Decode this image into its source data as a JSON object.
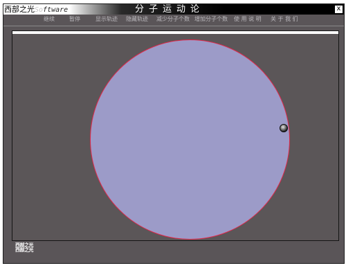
{
  "titlebar": {
    "logo_cn": "西部之光",
    "logo_so": "So",
    "logo_ftware": "ftware",
    "title": "分子运动论",
    "close_label": "x"
  },
  "menu": {
    "items": [
      {
        "label": "继续"
      },
      {
        "label": "暂停"
      },
      {
        "label": "显示轨迹"
      },
      {
        "label": "隐藏轨迹"
      },
      {
        "label": "减少分子个数"
      },
      {
        "label": "增加分子个数"
      },
      {
        "label": "使 用 说 明"
      },
      {
        "label": "关 于 我 们"
      }
    ]
  },
  "footer": {
    "logo_line1": "西部之光",
    "logo_line2": "西部之光"
  },
  "colors": {
    "window_bg": "#5a5558",
    "container_fill": "#9c9bc8",
    "container_border": "#e0284a",
    "menu_text": "#b9b7bb"
  }
}
